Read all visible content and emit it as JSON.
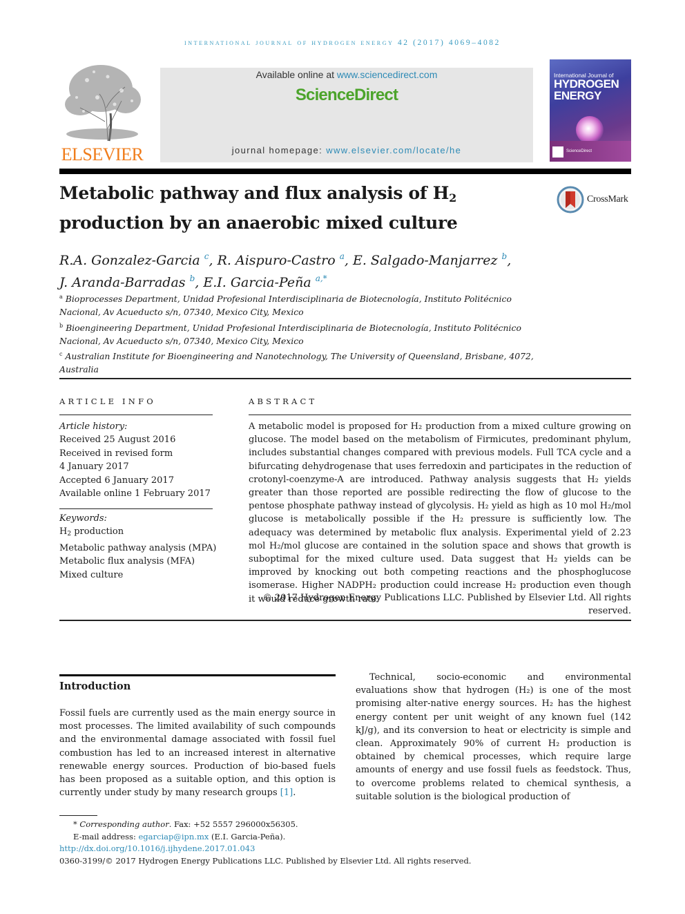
{
  "running_header": "INTERNATIONAL JOURNAL OF HYDROGEN ENERGY 42 (2017) 4069–4082",
  "masthead": {
    "publisher_logo": "tree-logo",
    "publisher_name": "ELSEVIER",
    "available_prefix": "Available online at ",
    "available_link": "www.sciencedirect.com",
    "platform_name": "ScienceDirect",
    "homepage_prefix": "journal homepage: ",
    "homepage_link": "www.elsevier.com/locate/he",
    "cover": {
      "line1": "International Journal of",
      "line2": "HYDROGEN",
      "line3": "ENERGY",
      "footer": "ScienceDirect"
    },
    "colors": {
      "elsevier_orange": "#f07d1c",
      "sciencedirect_green": "#4ca42b",
      "link_blue": "#2d8ab5",
      "banner_gray": "#e6e6e6"
    }
  },
  "article": {
    "title_part1": "Metabolic pathway and flux analysis of H",
    "title_sub": "2",
    "title_part2": "production by an anaerobic mixed culture",
    "crossmark_label": "CrossMark",
    "authors": [
      {
        "name": "R.A. Gonzalez-Garcia",
        "sup": "c",
        "sep": ", "
      },
      {
        "name": "R. Aispuro-Castro",
        "sup": "a",
        "sep": ", "
      },
      {
        "name": "E. Salgado-Manjarrez",
        "sup": "b",
        "sep": ","
      },
      {
        "name": "J. Aranda-Barradas",
        "sup": "b",
        "sep": ", "
      },
      {
        "name": "E.I. Garcia-Peña",
        "sup": "a,*",
        "sep": ""
      }
    ],
    "affiliations": [
      {
        "mark": "a",
        "text": "Bioprocesses Department, Unidad Profesional Interdisciplinaria de Biotecnología, Instituto Politécnico Nacional, Av Acueducto s/n, 07340, Mexico City, Mexico"
      },
      {
        "mark": "b",
        "text": "Bioengineering Department, Unidad Profesional Interdisciplinaria de Biotecnología, Instituto Politécnico Nacional, Av Acueducto s/n, 07340, Mexico City, Mexico"
      },
      {
        "mark": "c",
        "text": "Australian Institute for Bioengineering and Nanotechnology, The University of Queensland, Brisbane, 4072, Australia"
      }
    ]
  },
  "article_info": {
    "heading": "ARTICLE INFO",
    "history_label": "Article history:",
    "history": [
      "Received 25 August 2016",
      "Received in revised form",
      "4 January 2017",
      "Accepted 6 January 2017",
      "Available online 1 February 2017"
    ],
    "keywords_label": "Keywords:",
    "keywords": [
      "H2 production",
      "Metabolic pathway analysis (MPA)",
      "Metabolic flux analysis (MFA)",
      "Mixed culture"
    ]
  },
  "abstract": {
    "heading": "ABSTRACT",
    "text": "A metabolic model is proposed for H₂ production from a mixed culture growing on glucose. The model based on the metabolism of Firmicutes, predominant phylum, includes substantial changes compared with previous models. Full TCA cycle and a bifurcating dehydrogenase that uses ferredoxin and participates in the reduction of crotonyl-coenzyme-A are introduced. Pathway analysis suggests that H₂ yields greater than those reported are possible redirecting the flow of glucose to the pentose phosphate pathway instead of glycolysis. H₂ yield as high as 10 mol H₂/mol glucose is metabolically possible if the H₂ pressure is sufficiently low. The adequacy was determined by metabolic flux analysis. Experimental yield of 2.23 mol H₂/mol glucose are contained in the solution space and shows that growth is suboptimal for the mixed culture used. Data suggest that H₂ yields can be improved by knocking out both competing reactions and the phosphoglucose isomerase. Higher NADPH₂ production could increase H₂ production even though it would reduce growth rate.",
    "copyright": "© 2017 Hydrogen Energy Publications LLC. Published by Elsevier Ltd. All rights reserved."
  },
  "introduction": {
    "heading": "Introduction",
    "left_text": "Fossil fuels are currently used as the main energy source in most processes. The limited availability of such compounds and the environmental damage associated with fossil fuel combustion has led to an increased interest in alternative renewable energy sources. Production of bio-based fuels has been proposed as a suitable option, and this option is currently under study by many research groups ",
    "left_ref": "[1]",
    "left_end": ".",
    "right_text": "Technical, socio-economic and environmental evaluations show that hydrogen (H₂) is one of the most promising alter-native energy sources. H₂ has the highest energy content per unit weight of any known fuel (142 kJ/g), and its conversion to heat or electricity is simple and clean. Approximately 90% of current H₂ production is obtained by chemical processes, which require large amounts of energy and use fossil fuels as feedstock. Thus, to overcome problems related to chemical synthesis, a suitable solution is the biological production of"
  },
  "footnotes": {
    "corresponding_mark": "*",
    "corresponding_label": "Corresponding author",
    "corresponding_rest": ". Fax: +52 5557 296000x56305.",
    "email_label": "E-mail address: ",
    "email": "egarciap@ipn.mx",
    "email_suffix": " (E.I. Garcia-Peña).",
    "doi": "http://dx.doi.org/10.1016/j.ijhydene.2017.01.043",
    "issn_copyright": "0360-3199/© 2017 Hydrogen Energy Publications LLC. Published by Elsevier Ltd. All rights reserved."
  }
}
